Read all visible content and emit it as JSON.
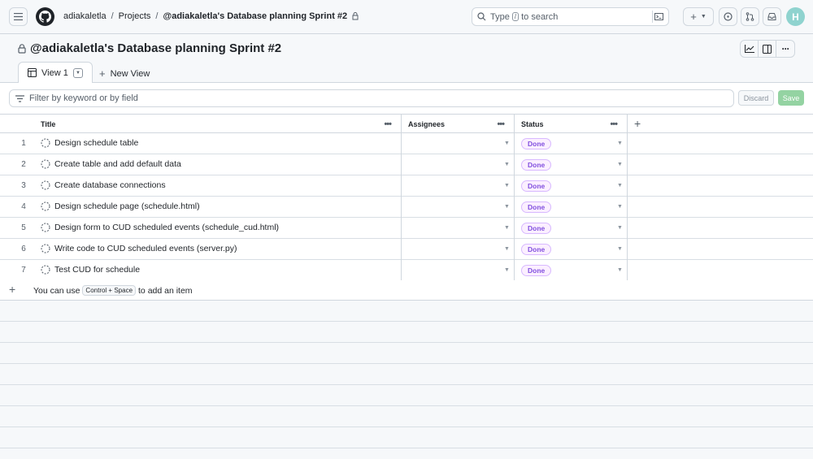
{
  "header": {
    "breadcrumbs": [
      "adiakaletla",
      "Projects",
      "@adiakaletla's Database planning Sprint #2"
    ],
    "search": {
      "prefix": "Type",
      "key": "/",
      "suffix": "to search"
    },
    "avatar_initial": "H"
  },
  "project": {
    "title": "@adiakaletla's Database planning Sprint #2"
  },
  "tabs": {
    "view1": "View 1",
    "new_view": "New View"
  },
  "filter": {
    "placeholder": "Filter by keyword or by field",
    "discard": "Discard",
    "save": "Save"
  },
  "table": {
    "columns": [
      "Title",
      "Assignees",
      "Status"
    ],
    "rows": [
      {
        "num": "1",
        "title": "Design schedule table",
        "status": "Done"
      },
      {
        "num": "2",
        "title": "Create table and add default data",
        "status": "Done"
      },
      {
        "num": "3",
        "title": "Create database connections",
        "status": "Done"
      },
      {
        "num": "4",
        "title": "Design schedule page (schedule.html)",
        "status": "Done"
      },
      {
        "num": "5",
        "title": "Design form to CUD scheduled events (schedule_cud.html)",
        "status": "Done"
      },
      {
        "num": "6",
        "title": "Write code to CUD scheduled events (server.py)",
        "status": "Done"
      },
      {
        "num": "7",
        "title": "Test CUD for schedule",
        "status": "Done"
      }
    ],
    "add_item": {
      "prefix": "You can use",
      "shortcut": "Control + Space",
      "suffix": "to add an item"
    }
  },
  "colors": {
    "accent": "#8250df",
    "save": "#94d3a2",
    "border": "#d0d7de"
  }
}
